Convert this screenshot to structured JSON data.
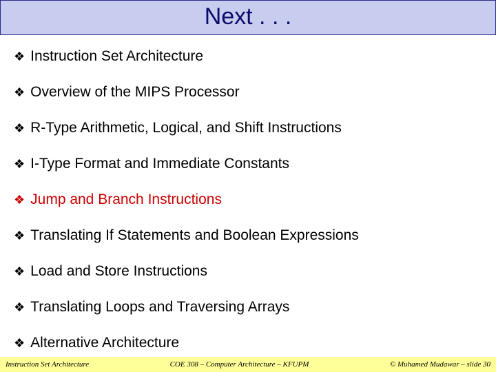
{
  "title": "Next . . .",
  "items": [
    {
      "text": "Instruction Set Architecture",
      "highlight": false
    },
    {
      "text": "Overview of the MIPS Processor",
      "highlight": false
    },
    {
      "text": "R-Type Arithmetic, Logical, and Shift Instructions",
      "highlight": false
    },
    {
      "text": "I-Type Format and Immediate Constants",
      "highlight": false
    },
    {
      "text": "Jump and Branch Instructions",
      "highlight": true
    },
    {
      "text": "Translating If Statements and Boolean Expressions",
      "highlight": false
    },
    {
      "text": "Load and Store Instructions",
      "highlight": false
    },
    {
      "text": "Translating Loops and Traversing Arrays",
      "highlight": false
    },
    {
      "text": "Alternative Architecture",
      "highlight": false
    }
  ],
  "footer": {
    "left": "Instruction Set Architecture",
    "center": "COE 308 – Computer Architecture – KFUPM",
    "right": "© Muhamed Mudawar – slide 30"
  },
  "bullet_glyph": "❖"
}
